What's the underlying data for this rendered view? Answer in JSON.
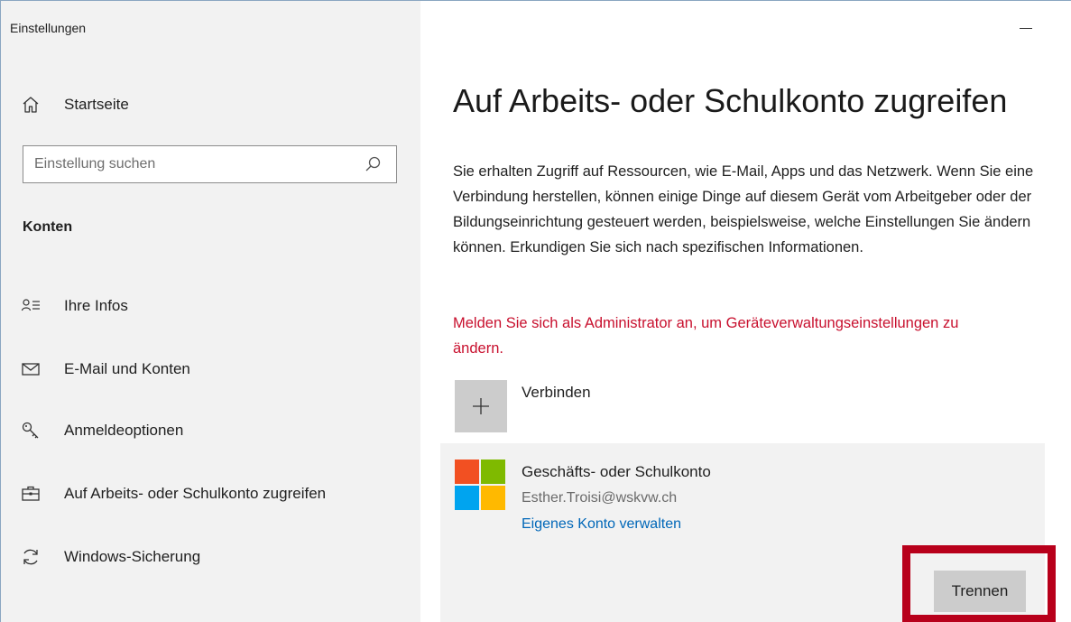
{
  "window": {
    "app_title": "Einstellungen",
    "minimize_icon": "minimize-icon"
  },
  "sidebar": {
    "home": {
      "label": "Startseite",
      "icon": "home-icon"
    },
    "search": {
      "placeholder": "Einstellung suchen",
      "value": "",
      "icon": "search-icon"
    },
    "section_title": "Konten",
    "items": [
      {
        "label": "Ihre Infos",
        "icon": "person-list-icon"
      },
      {
        "label": "E-Mail und Konten",
        "icon": "mail-icon"
      },
      {
        "label": "Anmeldeoptionen",
        "icon": "key-icon"
      },
      {
        "label": "Auf Arbeits- oder Schulkonto zugreifen",
        "icon": "briefcase-icon"
      },
      {
        "label": "Windows-Sicherung",
        "icon": "sync-icon"
      }
    ]
  },
  "main": {
    "title": "Auf Arbeits- oder Schulkonto zugreifen",
    "description": "Sie erhalten Zugriff auf Ressourcen, wie E-Mail, Apps und das Netzwerk. Wenn Sie eine Verbindung herstellen, können einige Dinge auf diesem Gerät vom Arbeitgeber oder der Bildungseinrichtung gesteuert werden, beispielsweise, welche Einstellungen Sie ändern können. Erkundigen Sie sich nach spezifischen Informationen.",
    "warning": "Melden Sie sich als Administrator an, um Geräteverwaltungseinstellungen zu ändern.",
    "warning_color": "#c8102e",
    "connect": {
      "label": "Verbinden",
      "icon": "plus-icon"
    },
    "account": {
      "type": "Geschäfts- oder Schulkonto",
      "email": "Esther.Troisi@wskvw.ch",
      "manage_link": "Eigenes Konto verwalten",
      "logo": "microsoft-logo",
      "disconnect_label": "Trennen"
    },
    "highlight_color": "#b8001b",
    "link_color": "#0067b8"
  }
}
